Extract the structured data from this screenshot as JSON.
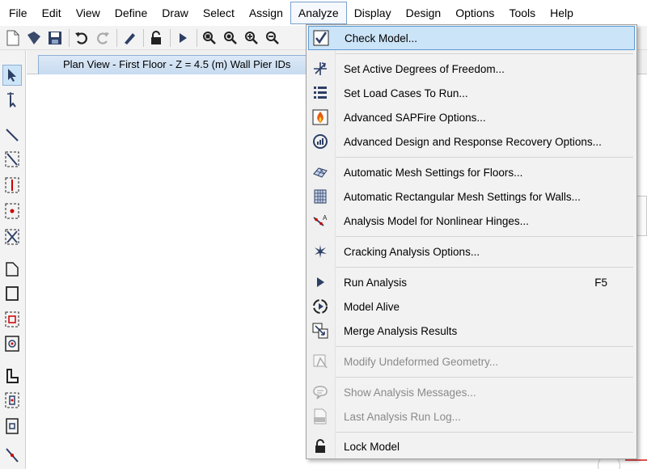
{
  "menubar": {
    "items": [
      "File",
      "Edit",
      "View",
      "Define",
      "Draw",
      "Select",
      "Assign",
      "Analyze",
      "Display",
      "Design",
      "Options",
      "Tools",
      "Help"
    ],
    "active": "Analyze"
  },
  "document": {
    "tab_title": "Plan View - First Floor - Z = 4.5 (m)  Wall Pier IDs"
  },
  "analyze_menu": {
    "items": [
      {
        "label": "Check Model...",
        "icon": "check-model-icon",
        "enabled": true
      },
      {
        "label": "Set Active Degrees of Freedom...",
        "icon": "degrees-of-freedom-icon",
        "enabled": true
      },
      {
        "label": "Set Load Cases To Run...",
        "icon": "load-cases-icon",
        "enabled": true
      },
      {
        "label": "Advanced SAPFire Options...",
        "icon": "sapfire-icon",
        "enabled": true
      },
      {
        "label": "Advanced Design and Response Recovery Options...",
        "icon": "response-recovery-icon",
        "enabled": true
      },
      {
        "label": "Automatic Mesh Settings for Floors...",
        "icon": "floor-mesh-icon",
        "enabled": true
      },
      {
        "label": "Automatic Rectangular Mesh Settings for Walls...",
        "icon": "wall-mesh-icon",
        "enabled": true
      },
      {
        "label": "Analysis Model for Nonlinear Hinges...",
        "icon": "nonlinear-hinges-icon",
        "enabled": true
      },
      {
        "label": "Cracking Analysis Options...",
        "icon": "cracking-icon",
        "enabled": true
      },
      {
        "label": "Run Analysis",
        "icon": "run-analysis-icon",
        "enabled": true,
        "shortcut": "F5"
      },
      {
        "label": "Model Alive",
        "icon": "model-alive-icon",
        "enabled": true
      },
      {
        "label": "Merge Analysis Results",
        "icon": "merge-results-icon",
        "enabled": true
      },
      {
        "label": "Modify Undeformed Geometry...",
        "icon": "modify-geometry-icon",
        "enabled": false
      },
      {
        "label": "Show Analysis Messages...",
        "icon": "analysis-messages-icon",
        "enabled": false
      },
      {
        "label": "Last Analysis Run Log...",
        "icon": "run-log-icon",
        "enabled": false
      },
      {
        "label": "Lock Model",
        "icon": "lock-model-icon",
        "enabled": true
      }
    ],
    "highlighted": "Check Model..."
  },
  "colors": {
    "highlight_bg": "#cce4f7",
    "highlight_border": "#5b9bd5",
    "disabled_text": "#8a8a8a"
  }
}
